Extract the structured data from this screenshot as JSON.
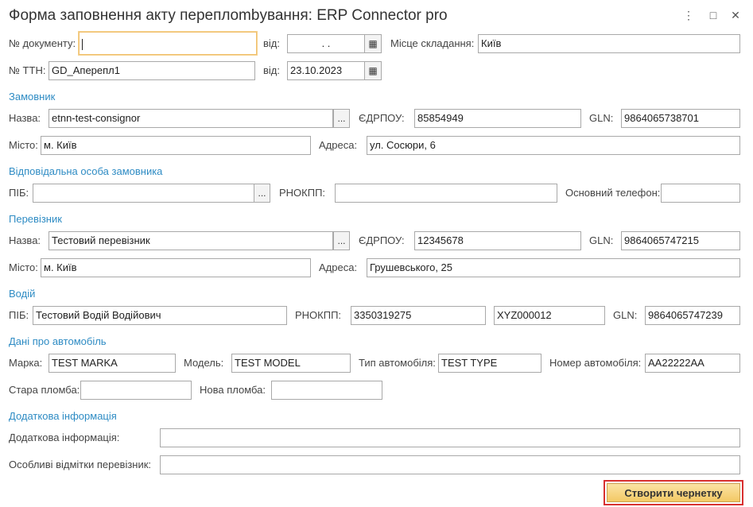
{
  "window": {
    "title": "Форма заповнення акту переплombування: ERP Connector pro",
    "more_icon": "⋮",
    "maximize_icon": "□",
    "close_icon": "✕"
  },
  "doc": {
    "number_label": "№ документу:",
    "number_value": "",
    "date_label": "від:",
    "date_value": " .  .",
    "place_label": "Місце складання:",
    "place_value": "Київ",
    "ttn_label": "№ ТТН:",
    "ttn_value": "GD_Аперепл1",
    "ttn_date_label": "від:",
    "ttn_date_value": "23.10.2023"
  },
  "customer": {
    "section": "Замовник",
    "name_label": "Назва:",
    "name_value": "etnn-test-consignor",
    "edrpou_label": "ЄДРПОУ:",
    "edrpou_value": "85854949",
    "gln_label": "GLN:",
    "gln_value": "9864065738701",
    "city_label": "Місто:",
    "city_value": "м. Київ",
    "address_label": "Адреса:",
    "address_value": "ул. Сосюри, 6"
  },
  "responsible": {
    "section": "Відповідальна особа замовника",
    "pib_label": "ПІБ:",
    "pib_value": "",
    "rnokpp_label": "РНОКПП:",
    "rnokpp_value": "",
    "phone_label": "Основний телефон:",
    "phone_value": ""
  },
  "carrier": {
    "section": "Перевізник",
    "name_label": "Назва:",
    "name_value": "Тестовий перевізник",
    "edrpou_label": "ЄДРПОУ:",
    "edrpou_value": "12345678",
    "gln_label": "GLN:",
    "gln_value": "9864065747215",
    "city_label": "Місто:",
    "city_value": "м. Київ",
    "address_label": "Адреса:",
    "address_value": "Грушевського, 25"
  },
  "driver": {
    "section": "Водій",
    "pib_label": "ПІБ:",
    "pib_value": "Тестовий Водій Водійович",
    "rnokpp_label": "РНОКПП:",
    "rnokpp_value": "3350319275",
    "license_value": "XYZ000012",
    "gln_label": "GLN:",
    "gln_value": "9864065747239"
  },
  "vehicle": {
    "section": "Дані про автомобіль",
    "brand_label": "Марка:",
    "brand_value": "TEST MARKA",
    "model_label": "Модель:",
    "model_value": "TEST MODEL",
    "type_label": "Тип автомобіля:",
    "type_value": "TEST TYPE",
    "plate_label": "Номер автомобіля:",
    "plate_value": "AA22222AA",
    "old_seal_label": "Стара пломба:",
    "old_seal_value": "",
    "new_seal_label": "Нова пломба:",
    "new_seal_value": ""
  },
  "extra": {
    "section": "Додаткова інформація",
    "info_label": "Додаткова інформація:",
    "info_value": "",
    "marks_label": "Особливі відмітки перевізник:",
    "marks_value": ""
  },
  "actions": {
    "create_label": "Створити чернетку",
    "select_label": "...",
    "calendar_icon": "▦"
  }
}
